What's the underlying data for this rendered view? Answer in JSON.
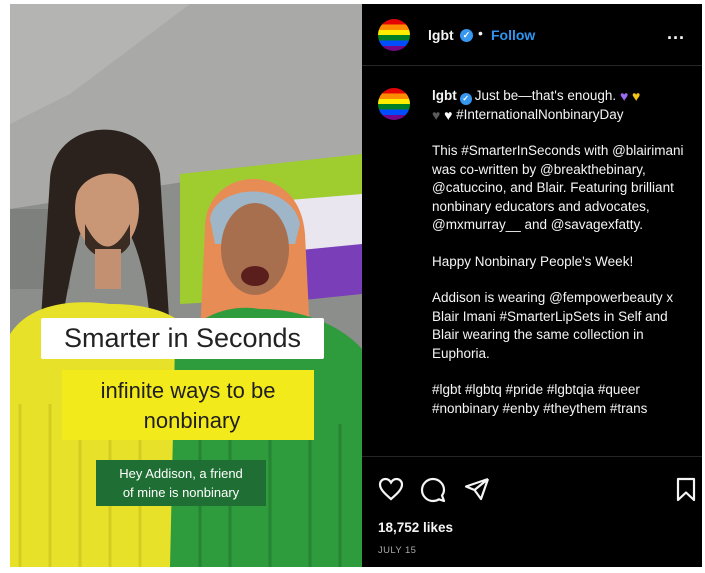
{
  "post": {
    "username": "lgbt",
    "follow_label": "Follow",
    "separator": "•",
    "more_label": "...",
    "caption_line1": "Just be—that's enough.",
    "caption_hashtag1": "#InternationalNonbinaryDay",
    "caption_paragraphs": [
      "This #SmarterInSeconds with @blairimani was co-written by @breakthebinary, @catuccino, and Blair. Featuring brilliant nonbinary educators and advocates, @mxmurray__ and @savagexfatty.",
      "Happy Nonbinary People's Week!",
      "Addison is wearing @fempowerbeauty x Blair Imani #SmarterLipSets in Self and Blair wearing the same collection in Euphoria.",
      "#lgbt #lgbtq #pride #lgbtqia #queer #nonbinary #enby #theythem #trans"
    ],
    "likes": "18,752 likes",
    "date": "JULY 15"
  },
  "video": {
    "title": "Smarter in Seconds",
    "subtitle_line1": "infinite ways to be",
    "subtitle_line2": "nonbinary",
    "quote_line1": "Hey Addison, a friend",
    "quote_line2": "of mine is nonbinary"
  },
  "icons": {
    "verified": "verified-badge-icon",
    "like": "heart-outline-icon",
    "comment": "comment-bubble-icon",
    "share": "paper-plane-icon",
    "save": "bookmark-icon",
    "heart_colors": [
      "#9b6cf0",
      "#f5c518",
      "#5a5a5a",
      "#ffffff"
    ]
  },
  "colors": {
    "accent": "#2e95f0",
    "panel_bg": "#000000",
    "caption_yellow": "#f3ea1c",
    "caption_green": "#1f6e33"
  }
}
